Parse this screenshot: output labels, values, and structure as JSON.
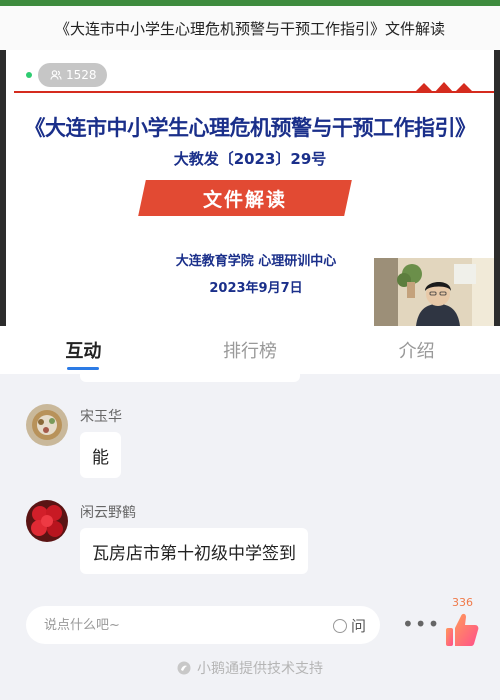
{
  "window": {
    "title": "《大连市中小学生心理危机预警与干预工作指引》文件解读"
  },
  "video": {
    "viewer_count": "1528",
    "document_title": "《大连市中小学生心理危机预警与干预工作指引》",
    "document_number": "大教发〔2023〕29号",
    "ribbon_text": "文件解读",
    "organization": "大连教育学院  心理研训中心",
    "date": "2023年9月7日"
  },
  "tabs": [
    {
      "label": "互动",
      "active": true
    },
    {
      "label": "排行榜",
      "active": false
    },
    {
      "label": "介绍",
      "active": false
    }
  ],
  "chat": {
    "messages": [
      {
        "nickname": "宋玉华",
        "text": "能"
      },
      {
        "nickname": "闲云野鹤",
        "text": "瓦房店市第十初级中学签到"
      }
    ]
  },
  "input": {
    "placeholder": "说点什么吧~",
    "ask_label": "问"
  },
  "like": {
    "count": "336"
  },
  "footer": {
    "text": "小鹅通提供技术支持"
  },
  "colors": {
    "accent": "#2c7be5",
    "title_blue": "#1a2f8a",
    "ribbon_red": "#e24a33",
    "live_green": "#2ecc71"
  }
}
